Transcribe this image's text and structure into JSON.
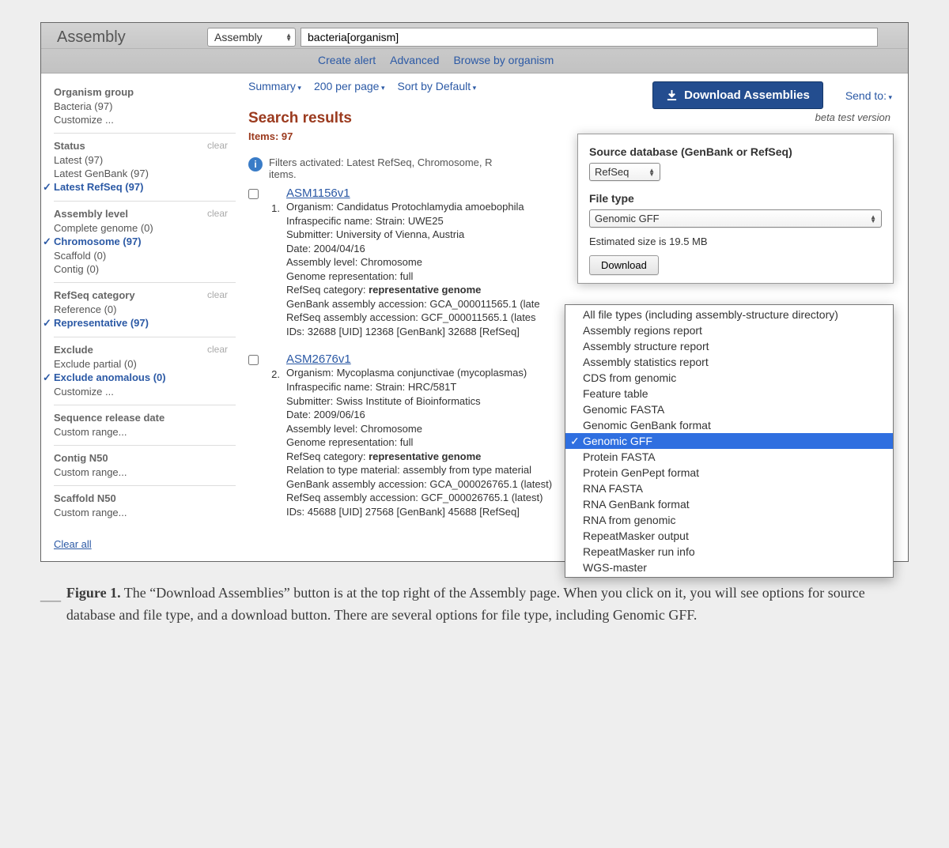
{
  "header": {
    "title": "Assembly",
    "db_select": "Assembly",
    "search_value": "bacteria[organism]",
    "sublinks": [
      "Create alert",
      "Advanced",
      "Browse by organism"
    ]
  },
  "toolbar": {
    "items": [
      "Summary",
      "200 per page",
      "Sort by Default"
    ],
    "download_label": "Download Assemblies",
    "send_to": "Send to:",
    "beta": "beta test version"
  },
  "sidebar": {
    "groups": [
      {
        "title": "Organism group",
        "items": [
          {
            "label": "Bacteria (97)"
          },
          {
            "label": "Customize ..."
          }
        ]
      },
      {
        "title": "Status",
        "clear": true,
        "items": [
          {
            "label": "Latest (97)"
          },
          {
            "label": "Latest GenBank (97)"
          },
          {
            "label": "Latest RefSeq (97)",
            "selected": true
          }
        ]
      },
      {
        "title": "Assembly level",
        "clear": true,
        "items": [
          {
            "label": "Complete genome (0)"
          },
          {
            "label": "Chromosome (97)",
            "selected": true
          },
          {
            "label": "Scaffold (0)"
          },
          {
            "label": "Contig (0)"
          }
        ]
      },
      {
        "title": "RefSeq category",
        "clear": true,
        "items": [
          {
            "label": "Reference (0)"
          },
          {
            "label": "Representative (97)",
            "selected": true
          }
        ]
      },
      {
        "title": "Exclude",
        "clear": true,
        "items": [
          {
            "label": "Exclude partial (0)"
          },
          {
            "label": "Exclude anomalous (0)",
            "selected": true
          },
          {
            "label": "Customize ..."
          }
        ]
      },
      {
        "title": "Sequence release date",
        "items": [
          {
            "label": "Custom range..."
          }
        ]
      },
      {
        "title": "Contig N50",
        "items": [
          {
            "label": "Custom range..."
          }
        ]
      },
      {
        "title": "Scaffold N50",
        "items": [
          {
            "label": "Custom range..."
          }
        ]
      }
    ],
    "clear_all": "Clear all",
    "clear_label": "clear"
  },
  "search": {
    "heading": "Search results",
    "items_line": "Items: 97",
    "filters_line": "Filters activated: Latest RefSeq, Chromosome, R",
    "filters_line2": "items."
  },
  "results": [
    {
      "num": "1.",
      "title": "ASM1156v1",
      "lines": [
        "Organism: Candidatus Protochlamydia amoebophila",
        "Infraspecific name: Strain: UWE25",
        "Submitter: University of Vienna, Austria",
        "Date: 2004/04/16",
        "Assembly level: Chromosome",
        "Genome representation: full",
        "RefSeq category: <b>representative genome</b>",
        "GenBank assembly accession: GCA_000011565.1 (late",
        "RefSeq assembly accession: GCF_000011565.1 (lates",
        "IDs: 32688 [UID] 12368 [GenBank] 32688 [RefSeq]"
      ]
    },
    {
      "num": "2.",
      "title": "ASM2676v1",
      "lines": [
        "Organism: Mycoplasma conjunctivae (mycoplasmas)",
        "Infraspecific name: Strain: HRC/581T",
        "Submitter: Swiss Institute of Bioinformatics",
        "Date: 2009/06/16",
        "Assembly level: Chromosome",
        "Genome representation: full",
        "RefSeq category: <b>representative genome</b>",
        "Relation to type material: assembly from type material",
        "GenBank assembly accession: GCA_000026765.1 (latest)",
        "RefSeq assembly accession: GCF_000026765.1 (latest)",
        "IDs: 45688 [UID] 27568 [GenBank] 45688 [RefSeq]"
      ]
    }
  ],
  "dl_panel": {
    "source_h": "Source database (GenBank or RefSeq)",
    "source_sel": "RefSeq",
    "filetype_h": "File type",
    "filetype_sel": "Genomic GFF",
    "estimated": "Estimated size is 19.5 MB",
    "button": "Download"
  },
  "filetype_list": [
    "All file types (including assembly-structure directory)",
    "Assembly regions report",
    "Assembly structure report",
    "Assembly statistics report",
    "CDS from genomic",
    "Feature table",
    "Genomic FASTA",
    "Genomic GenBank format",
    "Genomic GFF",
    "Protein FASTA",
    "Protein GenPept format",
    "RNA FASTA",
    "RNA GenBank format",
    "RNA from genomic",
    "RepeatMasker output",
    "RepeatMasker run info",
    "WGS-master"
  ],
  "filetype_selected": "Genomic GFF",
  "caption": {
    "label": "Figure 1.",
    "text": " The “Download Assemblies” button is at the top right of the Assembly page. When you click on it, you will see options for source database and file type, and a download button. There are several options for file type, including Genomic GFF."
  }
}
